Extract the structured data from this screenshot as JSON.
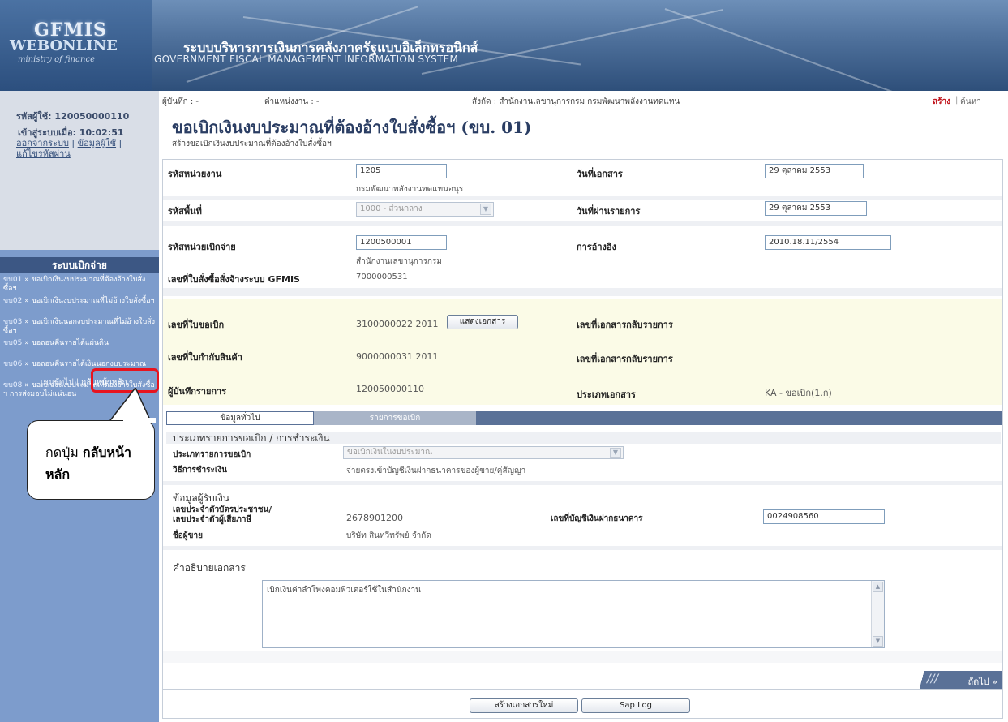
{
  "header": {
    "logo_line1": "GFMIS",
    "logo_line2": "WEBONLINE",
    "logo_line3": "ministry of finance",
    "title_th": "ระบบบริหารการเงินการคลังภาครัฐแบบอิเล็กทรอนิกส์",
    "title_en": "GOVERNMENT FISCAL MANAGEMENT INFORMATION SYSTEM"
  },
  "sidebar": {
    "user_id": "รหัสผู้ใช้: 120050000110",
    "login_time": "เข้าสู่ระบบเมื่อ: 10:02:51",
    "links": [
      "ออกจากระบบ",
      "ข้อมูลผู้ใช้",
      "แก้ไขรหัสผ่าน"
    ],
    "menu_title": "ระบบเบิกจ่าย",
    "items": [
      {
        "code": "ขบ01",
        "label": "ขอเบิกเงินงบประมาณที่ต้องอ้างใบสั่งซื้อฯ"
      },
      {
        "code": "ขบ02",
        "label": "ขอเบิกเงินงบประมาณที่ไม่อ้างใบสั่งซื้อฯ"
      },
      {
        "code": "ขบ03",
        "label": "ขอเบิกเงินนอกงบประมาณที่ไม่อ้างใบสั่งซื้อฯ"
      },
      {
        "code": "ขบ05",
        "label": "ขอถอนคืนรายได้แผ่นดิน"
      },
      {
        "code": "ขบ06",
        "label": "ขอถอนคืนรายได้เงินนอกงบประมาณ"
      },
      {
        "code": "ขบ08",
        "label": "ขอเบิกเงินงบประมาณที่ต้องอ้างใบสั่งซื้อ ฯ การส่งมอบไม่แน่นอน"
      }
    ],
    "next_menu": "เมนูถัดไป",
    "home": "กลับหน้าหลัก"
  },
  "callout": {
    "prefix": "กดปุ่ม ",
    "bold": "กลับหน้าหลัก"
  },
  "infobar": {
    "recorder": "ผู้บันทึก : -",
    "position": "ตำแหน่งงาน : -",
    "affiliation": "สังกัด : สำนักงานเลขานุการกรม กรมพัฒนาพลังงานทดแทน",
    "create": "สร้าง",
    "search": "ค้นหา"
  },
  "page": {
    "title": "ขอเบิกเงินงบประมาณที่ต้องอ้างใบสั่งซื้อฯ (ขบ. 01)",
    "subtitle": "สร้างขอเบิกเงินงบประมาณที่ต้องอ้างใบสั่งซื้อฯ"
  },
  "form": {
    "agency_code_label": "รหัสหน่วยงาน",
    "agency_code": "1205",
    "agency_name": "กรมพัฒนาพลังงานทดแทนอนุร",
    "doc_date_label": "วันที่เอกสาร",
    "doc_date": "29 ตุลาคม 2553",
    "area_code_label": "รหัสพื้นที่",
    "area_code": "1000 - ส่วนกลาง",
    "post_date_label": "วันที่ผ่านรายการ",
    "post_date": "29 ตุลาคม 2553",
    "disb_unit_label": "รหัสหน่วยเบิกจ่าย",
    "disb_unit": "1200500001",
    "disb_unit_name": "สำนักงานเลขานุการกรม",
    "reference_label": "การอ้างอิง",
    "reference": "2010.18.11/2554",
    "po_label": "เลขที่ใบสั่งซื้อสั่งจ้างระบบ GFMIS",
    "po": "7000000531",
    "request_no_label": "เลขที่ใบขอเบิก",
    "request_no": "3100000022  2011",
    "show_doc_btn": "แสดงเอกสาร",
    "reverse_doc_label": "เลขที่เอกสารกลับรายการ",
    "invoice_label": "เลขที่ใบกำกับสินค้า",
    "invoice": "9000000031 2011",
    "reverse_doc_label2": "เลขที่เอกสารกลับรายการ",
    "recorder_label": "ผู้บันทึกรายการ",
    "recorder": "120050000110",
    "doc_type_label": "ประเภทเอกสาร",
    "doc_type": "KA - ขอเบิก(1.ก)"
  },
  "tabs": {
    "general": "ข้อมูลทั่วไป",
    "items": "รายการขอเบิก"
  },
  "payment": {
    "section": "ประเภทรายการขอเบิก / การชำระเงิน",
    "type_label": "ประเภทรายการขอเบิก",
    "type_value": "ขอเบิกเงินในงบประมาณ",
    "method_label": "วิธีการชำระเงิน",
    "method_value": "จ่ายตรงเข้าบัญชีเงินฝากธนาคารของผู้ขาย/คู่สัญญา"
  },
  "payee": {
    "section": "ข้อมูลผู้รับเงิน",
    "id_label_1": "เลขประจำตัวบัตรประชาชน/",
    "id_label_2": "เลขประจำตัวผู้เสียภาษี",
    "id_value": "2678901200",
    "bank_label": "เลขที่บัญชีเงินฝากธนาคาร",
    "bank_value": "0024908560",
    "seller_label": "ชื่อผู้ขาย",
    "seller_value": "บริษัท สินทวีทรัพย์ จำกัด"
  },
  "description": {
    "section": "คำอธิบายเอกสาร",
    "text": "เบิกเงินค่าลำโพงคอมพิวเตอร์ใช้ในสำนักงาน"
  },
  "actions": {
    "next": "ถัดไป »",
    "new_doc": "สร้างเอกสารใหม่",
    "sap_log": "Sap Log"
  }
}
